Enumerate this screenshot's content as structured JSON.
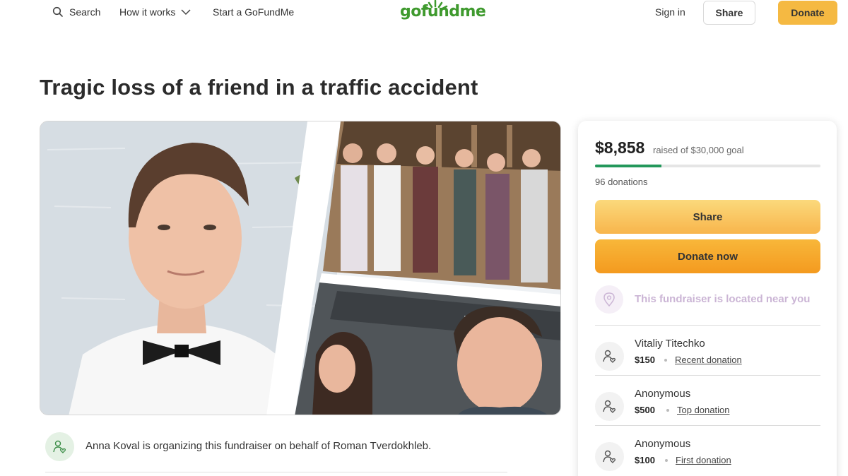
{
  "header": {
    "search_label": "Search",
    "how_label": "How it works",
    "start_label": "Start a GoFundMe",
    "logo_text": "gofundme",
    "signin_label": "Sign in",
    "share_label": "Share",
    "donate_label": "Donate"
  },
  "page_title": "Tragic loss of a friend in a traffic accident",
  "organizer_text": "Anna Koval is organizing this fundraiser on behalf of Roman Tverdokhleb.",
  "campaign": {
    "raised_amount": "$8,858",
    "raised_goal": "raised of $30,000 goal",
    "progress_fraction": 0.295,
    "donation_count": "96 donations",
    "share_label": "Share",
    "donate_label": "Donate now",
    "location_text": "This fundraiser is located near you"
  },
  "donations": [
    {
      "name": "Vitaliy Titechko",
      "amount": "$150",
      "tag": "Recent donation"
    },
    {
      "name": "Anonymous",
      "amount": "$500",
      "tag": "Top donation"
    },
    {
      "name": "Anonymous",
      "amount": "$100",
      "tag": "First donation"
    }
  ],
  "colors": {
    "brand_green": "#3f9a2e",
    "progress_green": "#23985b",
    "donate_orange": "#f49a1f",
    "share_yellow": "#fbd97c"
  },
  "icons": {
    "search": "search-icon",
    "how_chevron": "chevron-down-icon",
    "organizer": "people-heart-icon",
    "location": "location-pin-icon",
    "donor": "people-heart-icon"
  }
}
